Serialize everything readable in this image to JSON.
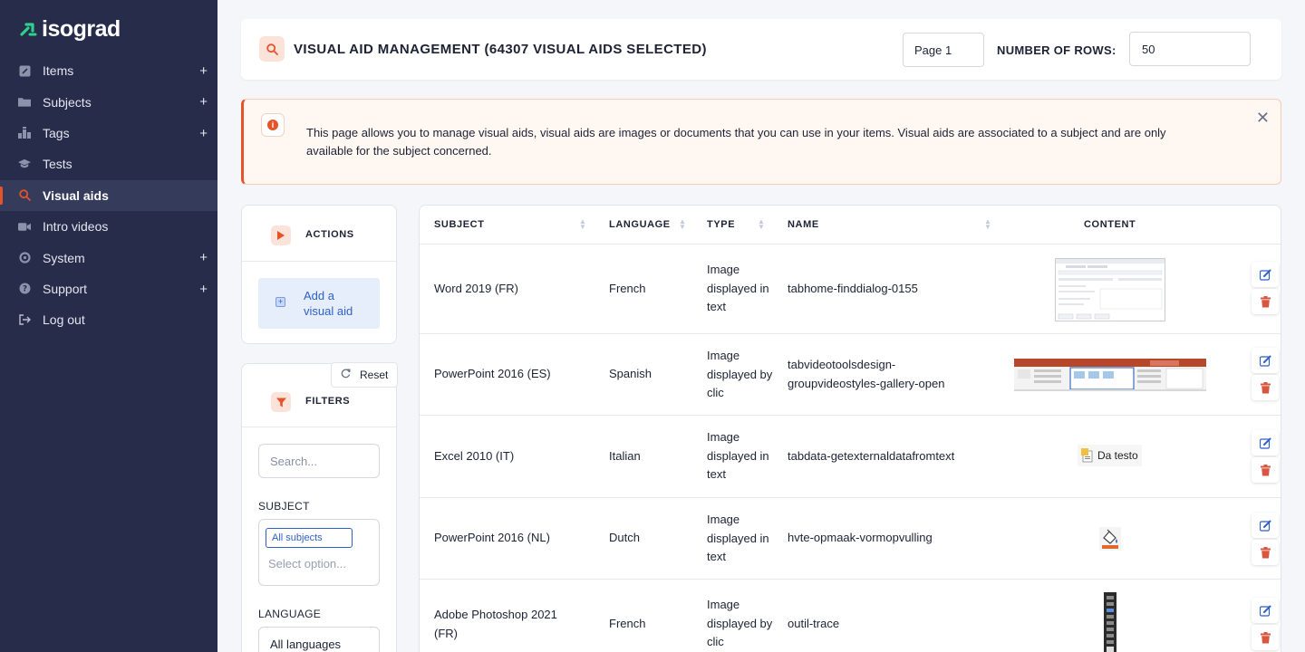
{
  "app": {
    "logo_text": "isograd"
  },
  "colors": {
    "sidebar_bg": "#262c4a",
    "accent": "#e5532b",
    "link": "#2f5fc9"
  },
  "sidebar": {
    "items": [
      {
        "label": "Items",
        "icon": "pencil-square-icon",
        "has_plus": true
      },
      {
        "label": "Subjects",
        "icon": "folder-icon",
        "has_plus": true
      },
      {
        "label": "Tags",
        "icon": "tags-icon",
        "has_plus": true
      },
      {
        "label": "Tests",
        "icon": "graduation-cap-icon",
        "has_plus": false
      },
      {
        "label": "Visual aids",
        "icon": "search-icon",
        "has_plus": false,
        "active": true
      },
      {
        "label": "Intro videos",
        "icon": "video-icon",
        "has_plus": false
      },
      {
        "label": "System",
        "icon": "gear-icon",
        "has_plus": true
      },
      {
        "label": "Support",
        "icon": "question-icon",
        "has_plus": true
      },
      {
        "label": "Log out",
        "icon": "logout-icon",
        "has_plus": false
      }
    ],
    "plus_glyph": "+"
  },
  "header": {
    "title": "VISUAL AID MANAGEMENT (64307 VISUAL AIDS SELECTED)",
    "page_value": "Page 1",
    "rows_label": "NUMBER OF ROWS:",
    "rows_value": "50"
  },
  "info": {
    "text": "This page allows you to manage visual aids, visual aids are images or documents that you can use in your items. Visual aids are associated to a subject and are only available for the subject concerned.",
    "icon_glyph": "i",
    "close_glyph": "✕"
  },
  "actions": {
    "title": "ACTIONS",
    "add_label": "Add a visual aid",
    "add_glyph": "+"
  },
  "filters": {
    "title": "FILTERS",
    "reset_label": "Reset",
    "search_placeholder": "Search...",
    "subject_label": "SUBJECT",
    "subject_chip": "All subjects",
    "subject_placeholder": "Select option...",
    "language_label": "LANGUAGE",
    "language_value": "All languages"
  },
  "table": {
    "columns": [
      "SUBJECT",
      "LANGUAGE",
      "TYPE",
      "NAME",
      "CONTENT"
    ],
    "rows": [
      {
        "subject": "Word 2019 (FR)",
        "language": "French",
        "type": "Image displayed in text",
        "name": "tabhome-finddialog-0155",
        "content": "find-dialog-screenshot"
      },
      {
        "subject": "PowerPoint 2016 (ES)",
        "language": "Spanish",
        "type": "Image displayed by clic",
        "name": "tabvideotoolsdesign-groupvideostyles-gallery-open",
        "content": "ribbon-screenshot"
      },
      {
        "subject": "Excel 2010 (IT)",
        "language": "Italian",
        "type": "Image displayed in text",
        "name": "tabdata-getexternaldatafromtext",
        "content": "Da testo"
      },
      {
        "subject": "PowerPoint 2016 (NL)",
        "language": "Dutch",
        "type": "Image displayed in text",
        "name": "hvte-opmaak-vormopvulling",
        "content": "paint-bucket-icon"
      },
      {
        "subject": "Adobe Photoshop 2021 (FR)",
        "language": "French",
        "type": "Image displayed by clic",
        "name": "outil-trace",
        "content": "toolbar-screenshot"
      }
    ]
  }
}
